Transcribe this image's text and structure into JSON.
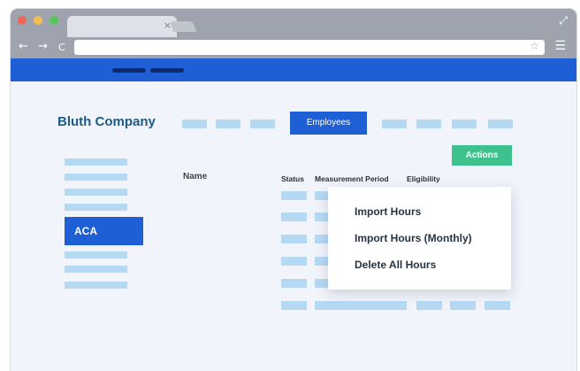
{
  "browser": {
    "tab_close": "×",
    "expand": "⤢",
    "back": "←",
    "forward": "→",
    "reload": "C",
    "url": "",
    "bookmark": "☆",
    "menu": "☰",
    "traffic_lights": [
      "#f0675b",
      "#f5bd4f",
      "#54c65a"
    ]
  },
  "app": {
    "company": "Bluth Company",
    "employees_tab": "Employees",
    "actions_button": "Actions",
    "sidebar_active": "ACA",
    "columns": {
      "name": "Name",
      "status": "Status",
      "measurement_period": "Measurement Period",
      "eligibility": "Eligibility"
    },
    "actions_menu": [
      "Import Hours",
      "Import Hours (Monthly)",
      "Delete All Hours"
    ]
  },
  "colors": {
    "brand_blue": "#1f5fd6",
    "accent_green": "#3ec18c",
    "company_text": "#1e5b86",
    "placeholder": "#b6d9f3"
  }
}
